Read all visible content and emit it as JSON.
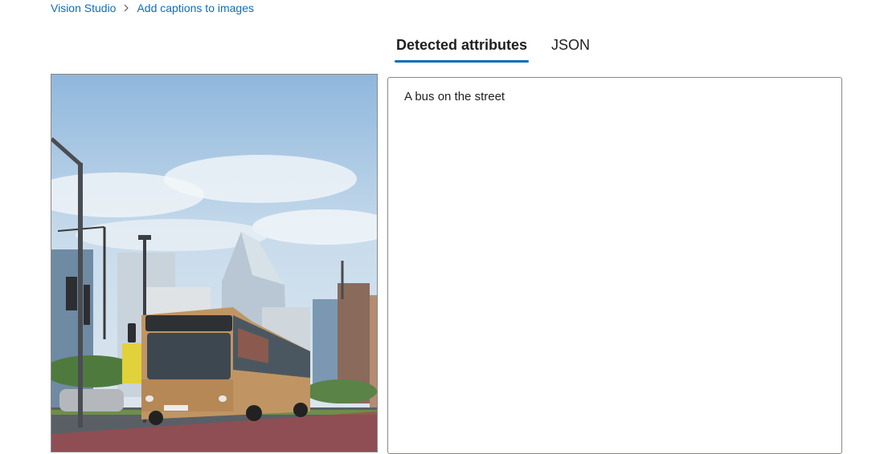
{
  "breadcrumb": {
    "items": [
      "Vision Studio",
      "Add captions to images"
    ]
  },
  "tabs": [
    {
      "label": "Detected attributes",
      "active": true
    },
    {
      "label": "JSON",
      "active": false
    }
  ],
  "result": {
    "caption": "A bus on the street"
  },
  "colors": {
    "accent": "#0f6cbd",
    "border": "#8a8886",
    "bus_body": "#c19563"
  },
  "icons": {
    "breadcrumb_separator": "chevron-right-icon"
  }
}
